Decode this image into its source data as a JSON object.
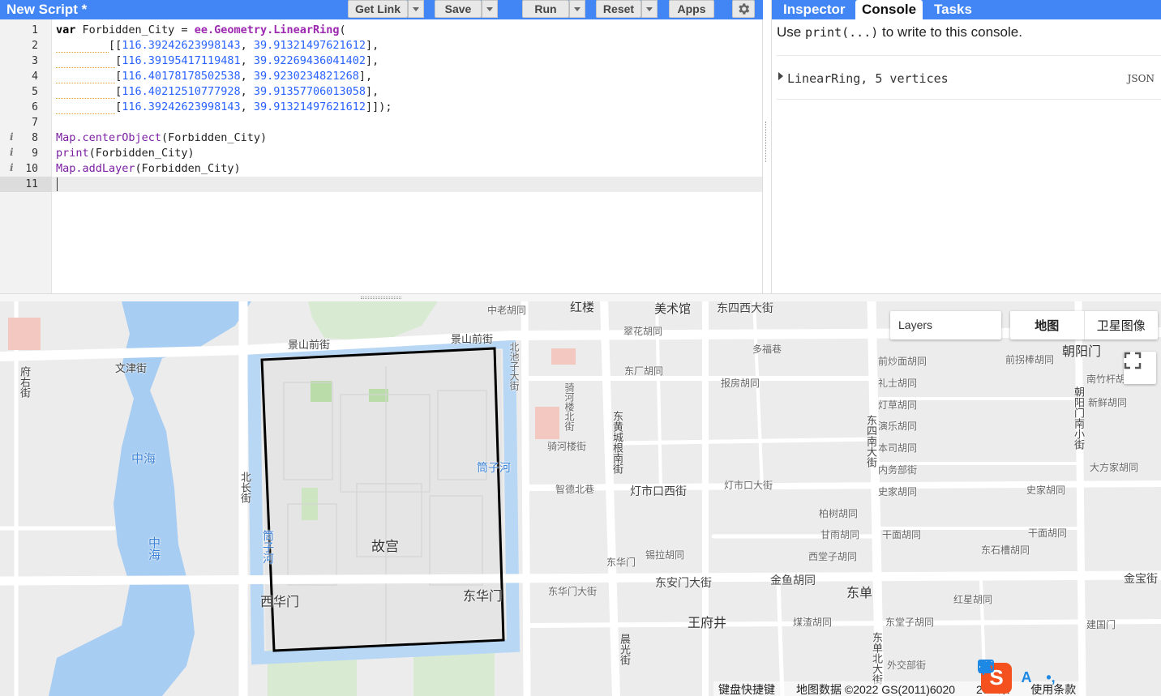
{
  "toolbar": {
    "script_title": "New Script *",
    "buttons": {
      "get_link": "Get Link",
      "save": "Save",
      "run": "Run",
      "reset": "Reset",
      "apps": "Apps"
    }
  },
  "right_tabs": {
    "inspector": "Inspector",
    "console": "Console",
    "tasks": "Tasks"
  },
  "console": {
    "hint_prefix": "Use",
    "hint_code": "print(...)",
    "hint_suffix": "to write to this console.",
    "output_label": "LinearRing, 5 vertices",
    "output_json": "JSON"
  },
  "editor": {
    "line_numbers": [
      "1",
      "2",
      "3",
      "4",
      "5",
      "6",
      "7",
      "8",
      "9",
      "10",
      "11"
    ],
    "coords": [
      [
        "116.39242623998143",
        "39.91321497621612"
      ],
      [
        "116.39195417119481",
        "39.92269436041402"
      ],
      [
        "116.40178178502538",
        "39.9230234821268"
      ],
      [
        "116.40212510777928",
        "39.91357706013058"
      ],
      [
        "116.39242623998143",
        "39.91321497621612"
      ]
    ],
    "line1": {
      "kw": "var",
      "name": " Forbidden_City = ",
      "fn": "ee.Geometry.LinearRing",
      "tail": "("
    },
    "line8": {
      "method": "Map.centerObject",
      "arg": "(Forbidden_City)"
    },
    "line9": {
      "method": "print",
      "arg": "(Forbidden_City)"
    },
    "line10": {
      "method": "Map.addLayer",
      "arg": "(Forbidden_City)"
    }
  },
  "map": {
    "layers_label": "Layers",
    "maptype": {
      "map": "地图",
      "satellite": "卫星图像"
    },
    "attribution": {
      "shortcuts": "键盘快捷键",
      "data": "地图数据 ©2022 GS(2011)6020",
      "scale": "200 米",
      "terms": "使用条款"
    },
    "labels": {
      "meishuguan": "美术馆",
      "hongqiao": "红楼",
      "dongsixidajie": "东四西大街",
      "zhonglao": "中老胡同",
      "jingshanqianjie1": "景山前街",
      "jingshanqianjie2": "景山前街",
      "wenjinjie": "文津街",
      "fuyoujie": "府右街",
      "zhonghai1": "中海",
      "zhonghai2": "中海",
      "beichangjie": "北长街",
      "gugong": "故宫",
      "xihuamen": "西华门",
      "donghuamen": "东华门",
      "tongzihe1": "筒子河",
      "tongzihe2": "筒子河",
      "beichizi": "北池子大街",
      "qiheloujie": "骑河楼北街",
      "qiheloujie2": "骑河楼街",
      "zhidebeixiang": "智德北巷",
      "dongchenggen": "东黄城根南街",
      "dengshikou": "灯市口西街",
      "dengshikoudajie": "灯市口大街",
      "donghuamen2": "东华门",
      "donghuamendajie": "东华门大街",
      "donganmendajie": "东安门大街",
      "wangfujing": "王府井",
      "jinyuhutong": "金鱼胡同",
      "dongdan": "东单",
      "chaoyangmen": "朝阳门",
      "jinbaojie": "金宝街",
      "cuihuahutong": "翠花胡同",
      "duofuxiang": "多福巷",
      "baofanghutong": "报房胡同",
      "dongchanghutong": "东厂胡同",
      "dongsinandajie": "东四南大街",
      "lishihutong": "礼士胡同",
      "dengcaohutong": "灯草胡同",
      "yanyuehutong": "演乐胡同",
      "bensihutong": "本司胡同",
      "neiwubujie": "内务部街",
      "shijiahutong": "史家胡同",
      "baishuhutong": "柏树胡同",
      "ganmianhutong": "甘雨胡同",
      "ganmianhutong2": "干面胡同",
      "xitangzi": "西堂子胡同",
      "xilahutong": "锡拉胡同",
      "qianchaomian": "前炒面胡同",
      "qianguaibang": "前拐棒胡同",
      "nanzhugan": "南竹杆胡",
      "xinxianhutong": "新鲜胡同",
      "dafangjia": "大方家胡同",
      "shijiahutong2": "史家胡同",
      "ganmianhutong3": "干面胡同",
      "dongshicao": "东石槽胡同",
      "honglouhutong": "红星胡同",
      "meizhahutong": "煤渣胡同",
      "dongtangzi": "东堂子胡同",
      "jianguomen": "建国门",
      "waijiaobu": "外交部街",
      "chaoyangmennanxiao": "朝阳门南小街",
      "dongdanbeidajie": "东单北大街",
      "xiaopaifang": "晨光街"
    }
  }
}
